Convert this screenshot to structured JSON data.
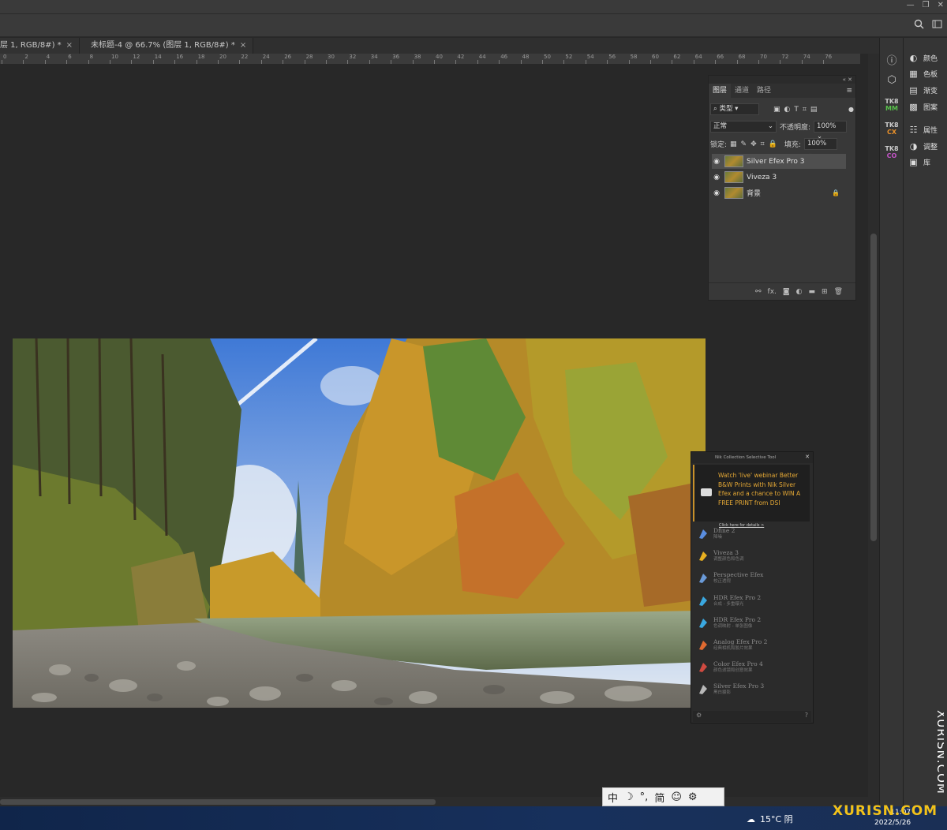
{
  "window": {
    "controls": [
      "—",
      "❐",
      "✕"
    ]
  },
  "optbar": {
    "icons": [
      "search-icon",
      "workspace-icon"
    ]
  },
  "tabs": [
    {
      "label": "层 1, RGB/8#) *",
      "close": "×"
    },
    {
      "label": "未标题-4 @ 66.7% (图层 1, RGB/8#) *",
      "close": "×"
    }
  ],
  "ruler": {
    "ticks": [
      "0",
      "2",
      "4",
      "6",
      "8",
      "10",
      "12",
      "14",
      "16",
      "18",
      "20",
      "22",
      "24",
      "26",
      "28",
      "30",
      "32",
      "34",
      "36",
      "38",
      "40",
      "42",
      "44",
      "46",
      "48",
      "50",
      "52",
      "54",
      "56",
      "58",
      "60",
      "62",
      "64",
      "66",
      "68",
      "70",
      "72",
      "74",
      "76"
    ]
  },
  "right_panels": {
    "items": [
      {
        "icon": "color-icon",
        "label": "颜色"
      },
      {
        "icon": "swatches-icon",
        "label": "色板"
      },
      {
        "icon": "gradient-icon",
        "label": "渐变"
      },
      {
        "icon": "pattern-icon",
        "label": "图案"
      },
      {
        "icon": "properties-icon",
        "label": "属性"
      },
      {
        "icon": "adjustments-icon",
        "label": "调整"
      },
      {
        "icon": "libraries-icon",
        "label": "库"
      }
    ],
    "tk": [
      {
        "top": "TK8",
        "bottom": "MM",
        "color": "#58c04b"
      },
      {
        "top": "TK8",
        "bottom": "CX",
        "color": "#e8902a"
      },
      {
        "top": "TK8",
        "bottom": "CO",
        "color": "#c454c8"
      }
    ]
  },
  "layers_panel": {
    "tabs": [
      "图层",
      "通道",
      "路径"
    ],
    "filter_label": "类型",
    "blend_mode": "正常",
    "opacity_label": "不透明度:",
    "opacity_value": "100%",
    "lock_label": "锁定:",
    "fill_label": "填充:",
    "fill_value": "100%",
    "layers": [
      {
        "name": "Silver Efex Pro 3",
        "selected": true,
        "locked": false
      },
      {
        "name": "Viveza 3",
        "selected": false,
        "locked": false
      },
      {
        "name": "背景",
        "selected": false,
        "locked": true
      }
    ],
    "footer_icons": [
      "link-icon",
      "fx-icon",
      "mask-icon",
      "adjustment-layer-icon",
      "folder-icon",
      "new-layer-icon",
      "trash-icon"
    ],
    "footer_fx": "fx."
  },
  "nik": {
    "title": "Nik Collection Selective Tool",
    "ad_text": "Watch 'live' webinar Better B&W Prints with Nik Silver Efex and a chance to WIN A FREE PRINT from DSI",
    "ad_link": "Click here for details >",
    "items": [
      {
        "name": "Dfine 2",
        "sub": "降噪",
        "color": "#5a8ee0"
      },
      {
        "name": "Viveza 3",
        "sub": "调整颜色和色调",
        "color": "#e8b020"
      },
      {
        "name": "Perspective Efex",
        "sub": "校正透视",
        "color": "#6a9ad8"
      },
      {
        "name": "HDR Efex Pro 2",
        "sub": "合成 - 多重曝光",
        "color": "#3aa8e0"
      },
      {
        "name": "HDR Efex Pro 2",
        "sub": "色调映射 - 单张图像",
        "color": "#3aa8e0"
      },
      {
        "name": "Analog Efex Pro 2",
        "sub": "经典相机和胶片效果",
        "color": "#e06a30"
      },
      {
        "name": "Color Efex Pro 4",
        "sub": "颜色滤镜和创意效果",
        "color": "#d04a40"
      },
      {
        "name": "Silver Efex Pro 3",
        "sub": "黑白摄影",
        "color": "#b8b8b8"
      }
    ]
  },
  "ime": {
    "items": [
      "中",
      "☽",
      "°,",
      "简",
      "☺",
      "⚙"
    ]
  },
  "taskbar": {
    "weather": "15°C 阴",
    "time": "11:07",
    "date": "2022/5/26"
  },
  "watermark": {
    "vertical": "XURISN.COM",
    "horizontal": "XURISN.COM"
  }
}
